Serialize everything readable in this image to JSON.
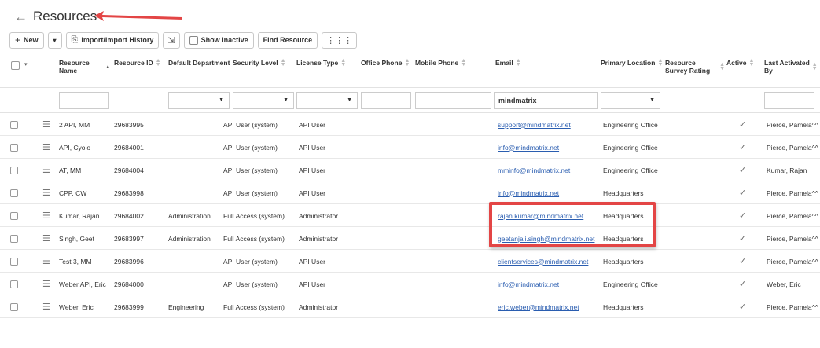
{
  "header": {
    "title": "Resources"
  },
  "toolbar": {
    "new_label": "New",
    "import_label": "Import/Import History",
    "show_inactive_label": "Show Inactive",
    "find_resource_label": "Find Resource"
  },
  "columns": [
    {
      "key": "name",
      "label_1": "Resource",
      "label_2": "Name",
      "sorted": true
    },
    {
      "key": "id",
      "label_1": "Resource ID",
      "label_2": ""
    },
    {
      "key": "dept",
      "label_1": "Default Department",
      "label_2": ""
    },
    {
      "key": "security",
      "label_1": "Security Level",
      "label_2": ""
    },
    {
      "key": "license",
      "label_1": "License Type",
      "label_2": ""
    },
    {
      "key": "office",
      "label_1": "Office Phone",
      "label_2": ""
    },
    {
      "key": "mobile",
      "label_1": "Mobile Phone",
      "label_2": ""
    },
    {
      "key": "email",
      "label_1": "Email",
      "label_2": ""
    },
    {
      "key": "location",
      "label_1": "Primary Location",
      "label_2": ""
    },
    {
      "key": "survey",
      "label_1": "Resource",
      "label_2": "Survey Rating"
    },
    {
      "key": "active",
      "label_1": "Active",
      "label_2": ""
    },
    {
      "key": "last",
      "label_1": "Last Activated",
      "label_2": "By"
    }
  ],
  "filters": {
    "email_value": "mindmatrix"
  },
  "rows": [
    {
      "name": "2 API, MM",
      "id": "29683995",
      "dept": "",
      "security": "API User (system)",
      "license": "API User",
      "email": "support@mindmatrix.net",
      "location": "Engineering Office",
      "active": "✓",
      "last": "Pierce, Pamela^^"
    },
    {
      "name": "API, Cyolo",
      "id": "29684001",
      "dept": "",
      "security": "API User (system)",
      "license": "API User",
      "email": "info@mindmatrix.net",
      "location": "Engineering Office",
      "active": "✓",
      "last": "Pierce, Pamela^^"
    },
    {
      "name": "AT, MM",
      "id": "29684004",
      "dept": "",
      "security": "API User (system)",
      "license": "API User",
      "email": "mminfo@mindmatrix.net",
      "location": "Engineering Office",
      "active": "✓",
      "last": "Kumar, Rajan"
    },
    {
      "name": "CPP, CW",
      "id": "29683998",
      "dept": "",
      "security": "API User (system)",
      "license": "API User",
      "email": "info@mindmatrix.net",
      "location": "Headquarters",
      "active": "✓",
      "last": "Pierce, Pamela^^"
    },
    {
      "name": "Kumar, Rajan",
      "id": "29684002",
      "dept": "Administration",
      "security": "Full Access (system)",
      "license": "Administrator",
      "email": "rajan.kumar@mindmatrix.net",
      "location": "Headquarters",
      "active": "✓",
      "last": "Pierce, Pamela^^"
    },
    {
      "name": "Singh, Geet",
      "id": "29683997",
      "dept": "Administration",
      "security": "Full Access (system)",
      "license": "Administrator",
      "email": "geetanjali.singh@mindmatrix.net",
      "location": "Headquarters",
      "active": "✓",
      "last": "Pierce, Pamela^^"
    },
    {
      "name": "Test 3, MM",
      "id": "29683996",
      "dept": "",
      "security": "API User (system)",
      "license": "API User",
      "email": "clientservices@mindmatrix.net",
      "location": "Headquarters",
      "active": "✓",
      "last": "Pierce, Pamela^^"
    },
    {
      "name": "Weber API, Eric",
      "id": "29684000",
      "dept": "",
      "security": "API User (system)",
      "license": "API User",
      "email": "info@mindmatrix.net",
      "location": "Engineering Office",
      "active": "✓",
      "last": "Weber, Eric"
    },
    {
      "name": "Weber, Eric",
      "id": "29683999",
      "dept": "Engineering",
      "security": "Full Access (system)",
      "license": "Administrator",
      "email": "eric.weber@mindmatrix.net",
      "location": "Headquarters",
      "active": "✓",
      "last": "Pierce, Pamela^^"
    }
  ],
  "colors": {
    "accent_red": "#e34545",
    "link_blue": "#2a5db0"
  }
}
